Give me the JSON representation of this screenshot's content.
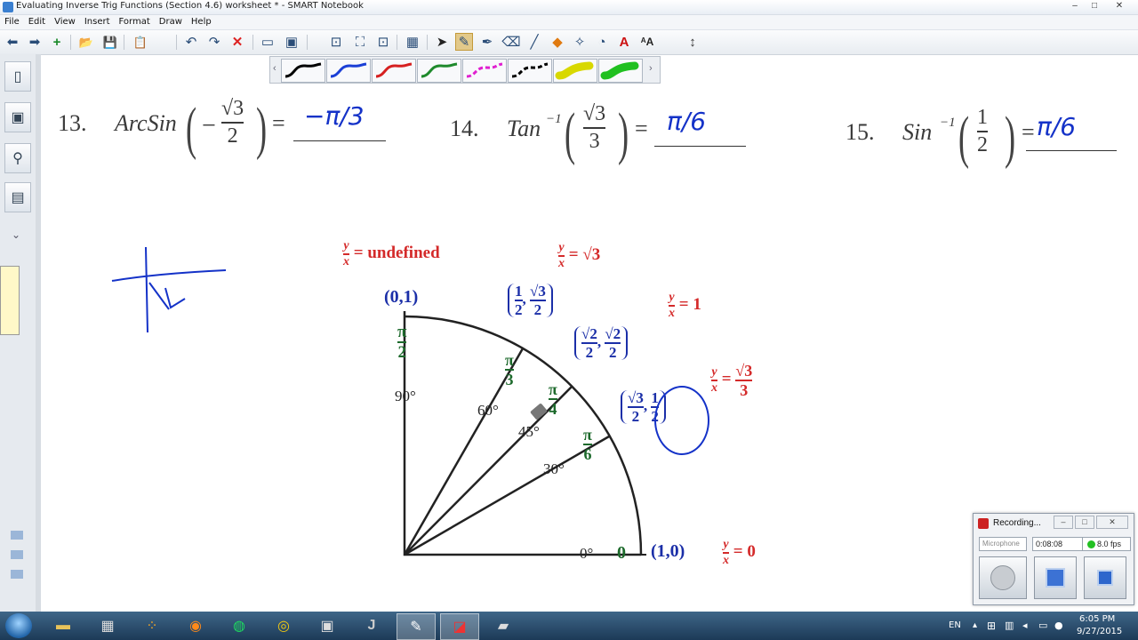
{
  "window": {
    "title": "Evaluating Inverse Trig Functions (Section 4.6) worksheet * - SMART Notebook",
    "buttons": {
      "minimize": "–",
      "maximize": "□",
      "close": "✕"
    }
  },
  "menu": [
    "File",
    "Edit",
    "View",
    "Insert",
    "Format",
    "Draw",
    "Help"
  ],
  "toolbar": {
    "icons": [
      "back-icon",
      "forward-icon",
      "add-page-icon",
      "open-icon",
      "save-icon",
      "paste-icon",
      "undo-icon",
      "redo-icon",
      "delete-icon",
      "screen-shade-icon",
      "display-icon",
      "capture-icon",
      "fullscreen-icon",
      "table-icon",
      "select-icon",
      "pen-icon",
      "creative-pen-icon",
      "eraser-icon",
      "line-icon",
      "shape-icon",
      "magic-pen-icon",
      "fill-icon",
      "text-icon",
      "font-icon",
      "move-toolbar-icon"
    ],
    "glyphs": {
      "back": "⬅",
      "forward": "➡",
      "add_page": "+",
      "open": "📂",
      "save": "💾",
      "paste": "📋",
      "undo": "↶",
      "redo": "↷",
      "delete": "✕",
      "screen_shade": "▭",
      "display": "▣",
      "capture": "⊡",
      "fullscreen": "⛶",
      "table": "▦",
      "select": "➤",
      "pen": "✎",
      "creative_pen": "✒",
      "eraser": "⌫",
      "line": "╱",
      "shape": "◆",
      "magic_pen": "✧",
      "fill": "◔",
      "text": "A",
      "font": "ᴬA",
      "move": "↕"
    }
  },
  "pen_tray": {
    "colors": [
      "#000000",
      "#1b3fd6",
      "#d62020",
      "#1f8a2c",
      "#e020d0",
      "#000000",
      "#d8d800",
      "#20c020"
    ],
    "left_arrow": "‹",
    "right_arrow": "›"
  },
  "side_tabs": {
    "icons": [
      "page-sorter-icon",
      "gallery-icon",
      "attachments-icon",
      "properties-icon"
    ],
    "glyphs": {
      "page_sorter": "▯",
      "gallery": "▣",
      "attachments": "⚲",
      "properties": "▤"
    },
    "collapse": "⌄"
  },
  "problems": [
    {
      "number": "13.",
      "function": "ArcSin",
      "sign": "−",
      "numerator": "√3",
      "denominator": "2",
      "equals": "=",
      "answer": "−π/3"
    },
    {
      "number": "14.",
      "function": "Tan",
      "exponent": "−1",
      "numerator": "√3",
      "denominator": "3",
      "equals": "=",
      "answer": "π/6"
    },
    {
      "number": "15.",
      "function": "Sin",
      "exponent": "−1",
      "numerator": "1",
      "denominator": "2",
      "equals": "=",
      "answer": "π/6"
    }
  ],
  "diagram": {
    "points": {
      "p90": "(0,1)",
      "p0": "(1,0)",
      "p60": {
        "x_num": "1",
        "x_den": "2",
        "y_num": "√3",
        "y_den": "2"
      },
      "p45": {
        "x_num": "√2",
        "x_den": "2",
        "y_num": "√2",
        "y_den": "2"
      },
      "p30": {
        "x_num": "√3",
        "x_den": "2",
        "y_num": "1",
        "y_den": "2"
      }
    },
    "degrees": {
      "d90": "90°",
      "d60": "60°",
      "d45": "45°",
      "d30": "30°",
      "d0": "0°"
    },
    "radians": {
      "r90": {
        "num": "π",
        "den": "2"
      },
      "r60": {
        "num": "π",
        "den": "3"
      },
      "r45": {
        "num": "π",
        "den": "4"
      },
      "r30": {
        "num": "π",
        "den": "6"
      },
      "r0": "0"
    },
    "ratios": {
      "r90": {
        "num": "y",
        "den": "x",
        "value": "= undefined"
      },
      "r60": {
        "num": "y",
        "den": "x",
        "value": "= √3"
      },
      "r45": {
        "num": "y",
        "den": "x",
        "value": "= 1"
      },
      "r30": {
        "num": "y",
        "den": "x",
        "value": "=",
        "value_num": "√3",
        "value_den": "3"
      },
      "r0": {
        "num": "y",
        "den": "x",
        "value": "= 0"
      }
    }
  },
  "recorder": {
    "title": "Recording...",
    "dropdown": "Microphone",
    "elapsed": "0:08:08",
    "fps": "8.0 fps",
    "status_color": "#22c022"
  },
  "taskbar": {
    "apps": [
      "file-explorer-icon",
      "calculator-icon",
      "app-grid-icon",
      "firefox-icon",
      "spotify-icon",
      "chrome-icon",
      "terminal-icon",
      "j-app-icon",
      "smart-notebook-icon",
      "smart-recorder-icon",
      "tablet-icon"
    ],
    "glyphs": {
      "file_explorer": "▬",
      "calculator": "▦",
      "app_grid": "⁘",
      "firefox": "◉",
      "spotify": "◍",
      "chrome": "◎",
      "terminal": "▣",
      "j_app": "J",
      "smart_notebook": "✎",
      "smart_recorder": "◪",
      "tablet": "▰"
    },
    "language": "EN",
    "time": "6:05 PM",
    "date": "9/27/2015"
  }
}
